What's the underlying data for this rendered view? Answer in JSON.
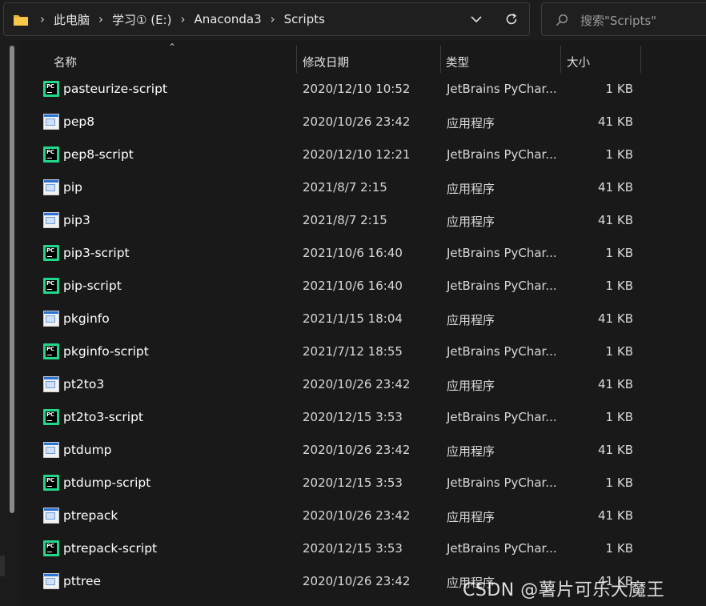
{
  "address_bar": {
    "breadcrumbs": [
      "此电脑",
      "学习① (E:)",
      "Anaconda3",
      "Scripts"
    ]
  },
  "search": {
    "placeholder": "搜索\"Scripts\""
  },
  "columns": {
    "name": "名称",
    "modified": "修改日期",
    "type": "类型",
    "size": "大小"
  },
  "files": [
    {
      "name": "pasteurize-script",
      "modified": "2020/12/10 10:52",
      "type": "JetBrains PyChar...",
      "size": "1 KB",
      "icon": "pycharm-icon"
    },
    {
      "name": "pep8",
      "modified": "2020/10/26 23:42",
      "type": "应用程序",
      "size": "41 KB",
      "icon": "exe-icon"
    },
    {
      "name": "pep8-script",
      "modified": "2020/12/10 12:21",
      "type": "JetBrains PyChar...",
      "size": "1 KB",
      "icon": "pycharm-icon"
    },
    {
      "name": "pip",
      "modified": "2021/8/7 2:15",
      "type": "应用程序",
      "size": "41 KB",
      "icon": "exe-icon"
    },
    {
      "name": "pip3",
      "modified": "2021/8/7 2:15",
      "type": "应用程序",
      "size": "41 KB",
      "icon": "exe-icon"
    },
    {
      "name": "pip3-script",
      "modified": "2021/10/6 16:40",
      "type": "JetBrains PyChar...",
      "size": "1 KB",
      "icon": "pycharm-icon"
    },
    {
      "name": "pip-script",
      "modified": "2021/10/6 16:40",
      "type": "JetBrains PyChar...",
      "size": "1 KB",
      "icon": "pycharm-icon"
    },
    {
      "name": "pkginfo",
      "modified": "2021/1/15 18:04",
      "type": "应用程序",
      "size": "41 KB",
      "icon": "exe-icon"
    },
    {
      "name": "pkginfo-script",
      "modified": "2021/7/12 18:55",
      "type": "JetBrains PyChar...",
      "size": "1 KB",
      "icon": "pycharm-icon"
    },
    {
      "name": "pt2to3",
      "modified": "2020/10/26 23:42",
      "type": "应用程序",
      "size": "41 KB",
      "icon": "exe-icon"
    },
    {
      "name": "pt2to3-script",
      "modified": "2020/12/15 3:53",
      "type": "JetBrains PyChar...",
      "size": "1 KB",
      "icon": "pycharm-icon"
    },
    {
      "name": "ptdump",
      "modified": "2020/10/26 23:42",
      "type": "应用程序",
      "size": "41 KB",
      "icon": "exe-icon"
    },
    {
      "name": "ptdump-script",
      "modified": "2020/12/15 3:53",
      "type": "JetBrains PyChar...",
      "size": "1 KB",
      "icon": "pycharm-icon"
    },
    {
      "name": "ptrepack",
      "modified": "2020/10/26 23:42",
      "type": "应用程序",
      "size": "41 KB",
      "icon": "exe-icon"
    },
    {
      "name": "ptrepack-script",
      "modified": "2020/12/15 3:53",
      "type": "JetBrains PyChar...",
      "size": "1 KB",
      "icon": "pycharm-icon"
    },
    {
      "name": "pttree",
      "modified": "2020/10/26 23:42",
      "type": "应用程序",
      "size": "41 KB",
      "icon": "exe-icon"
    }
  ],
  "watermark": "CSDN @薯片可乐大魔王",
  "colors": {
    "background": "#191919",
    "pycharm_green": "#21d789",
    "exe_blue": "#2a72d4"
  }
}
